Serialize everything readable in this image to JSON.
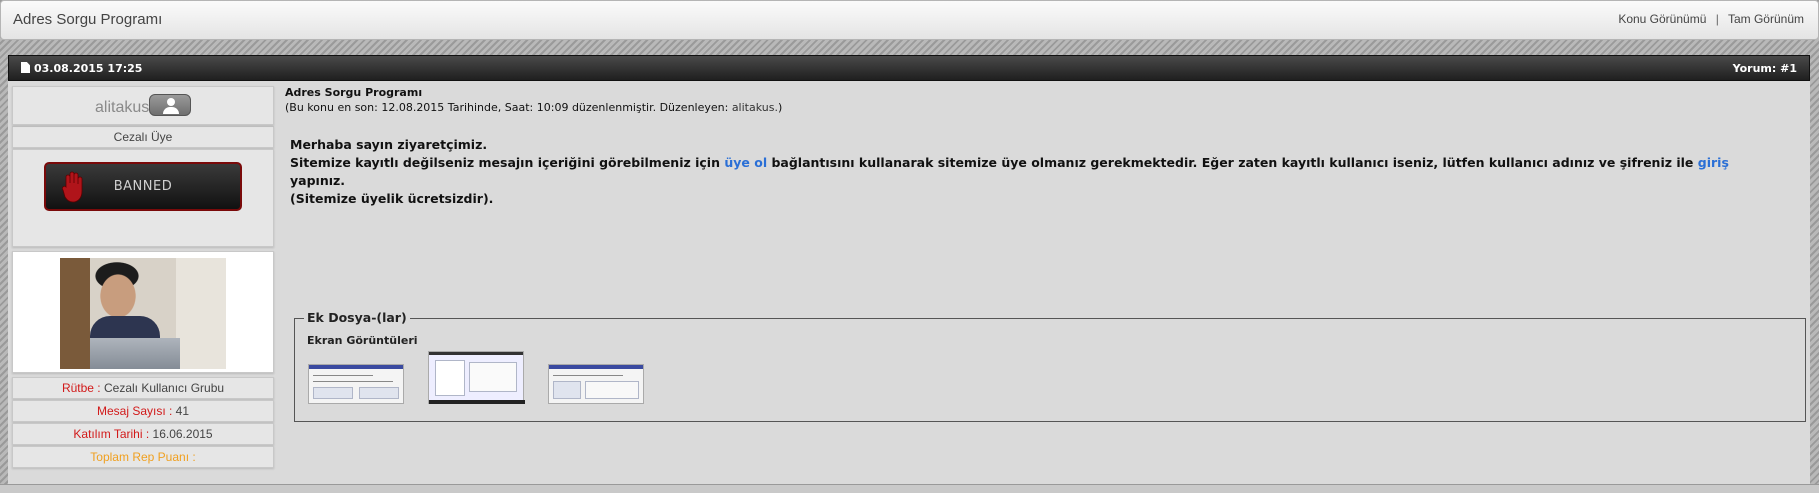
{
  "header": {
    "title": "Adres Sorgu Programı",
    "links": [
      "Konu Görünümü",
      "Tam Görünüm"
    ],
    "separator": "|"
  },
  "post": {
    "date": "03.08.2015 17:25",
    "comment_no": "Yorum: #1",
    "title": "Adres Sorgu Programı",
    "edited_prefix": "(Bu konu en son: 12.08.2015 Tarihinde, Saat: 10:09 düzenlenmiştir. Düzenleyen: ",
    "edited_by": "alitakus.",
    "edited_suffix": ")",
    "message": {
      "line1": "Merhaba sayın ziyaretçimiz.",
      "line2_a": "Sitemize kayıtlı değilseniz mesajın içeriğini görebilmeniz için ",
      "link_register": "üye ol",
      "line2_b": " bağlantısını kullanarak sitemize üye olmanız gerekmektedir. Eğer zaten kayıtlı kullanıcı iseniz, lütfen kullanıcı adınız ve şifreniz ile ",
      "link_login": "giriş",
      "line2_c": " yapınız.",
      "line3": "(Sitemize üyelik ücretsizdir)."
    },
    "attachments": {
      "legend": "Ek Dosya-(lar)",
      "subtitle": "Ekran Görüntüleri",
      "thumb_count": 3
    }
  },
  "user": {
    "name": "alitakus",
    "icon": "user-icon",
    "role": "Cezalı Üye",
    "banned_label": "BANNED",
    "banned_icon": "hand-stop-icon",
    "rank_label": "Rütbe : ",
    "rank_value": "Cezalı Kullanıcı Grubu",
    "posts_label": "Mesaj Sayısı : ",
    "posts_value": "41",
    "joined_label": "Katılım Tarihi : ",
    "joined_value": "16.06.2015",
    "rep_label": "Toplam Rep Puanı : ",
    "rep_value": ""
  },
  "colors": {
    "label_red": "#d21a1a",
    "label_orange": "#f0a020",
    "link_blue": "#2a6fd6",
    "header_dark": "#1f1f1f"
  }
}
